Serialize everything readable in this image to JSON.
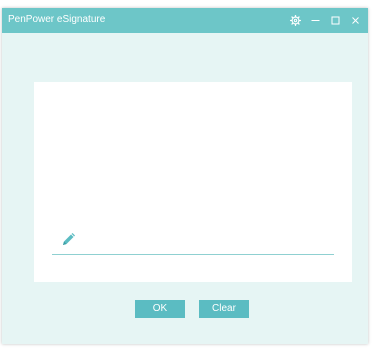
{
  "window": {
    "title": "PenPower eSignature"
  },
  "titlebar": {
    "icons": [
      "settings-icon",
      "minimize-icon",
      "maximize-icon",
      "close-icon"
    ]
  },
  "signature_area": {
    "icon": "pen-icon"
  },
  "buttons": {
    "ok_label": "OK",
    "clear_label": "Clear"
  },
  "colors": {
    "titlebar": "#6dc6c8",
    "background": "#e6f5f4",
    "accent": "#5bbcc2",
    "signature_line": "#8fd0d1"
  }
}
